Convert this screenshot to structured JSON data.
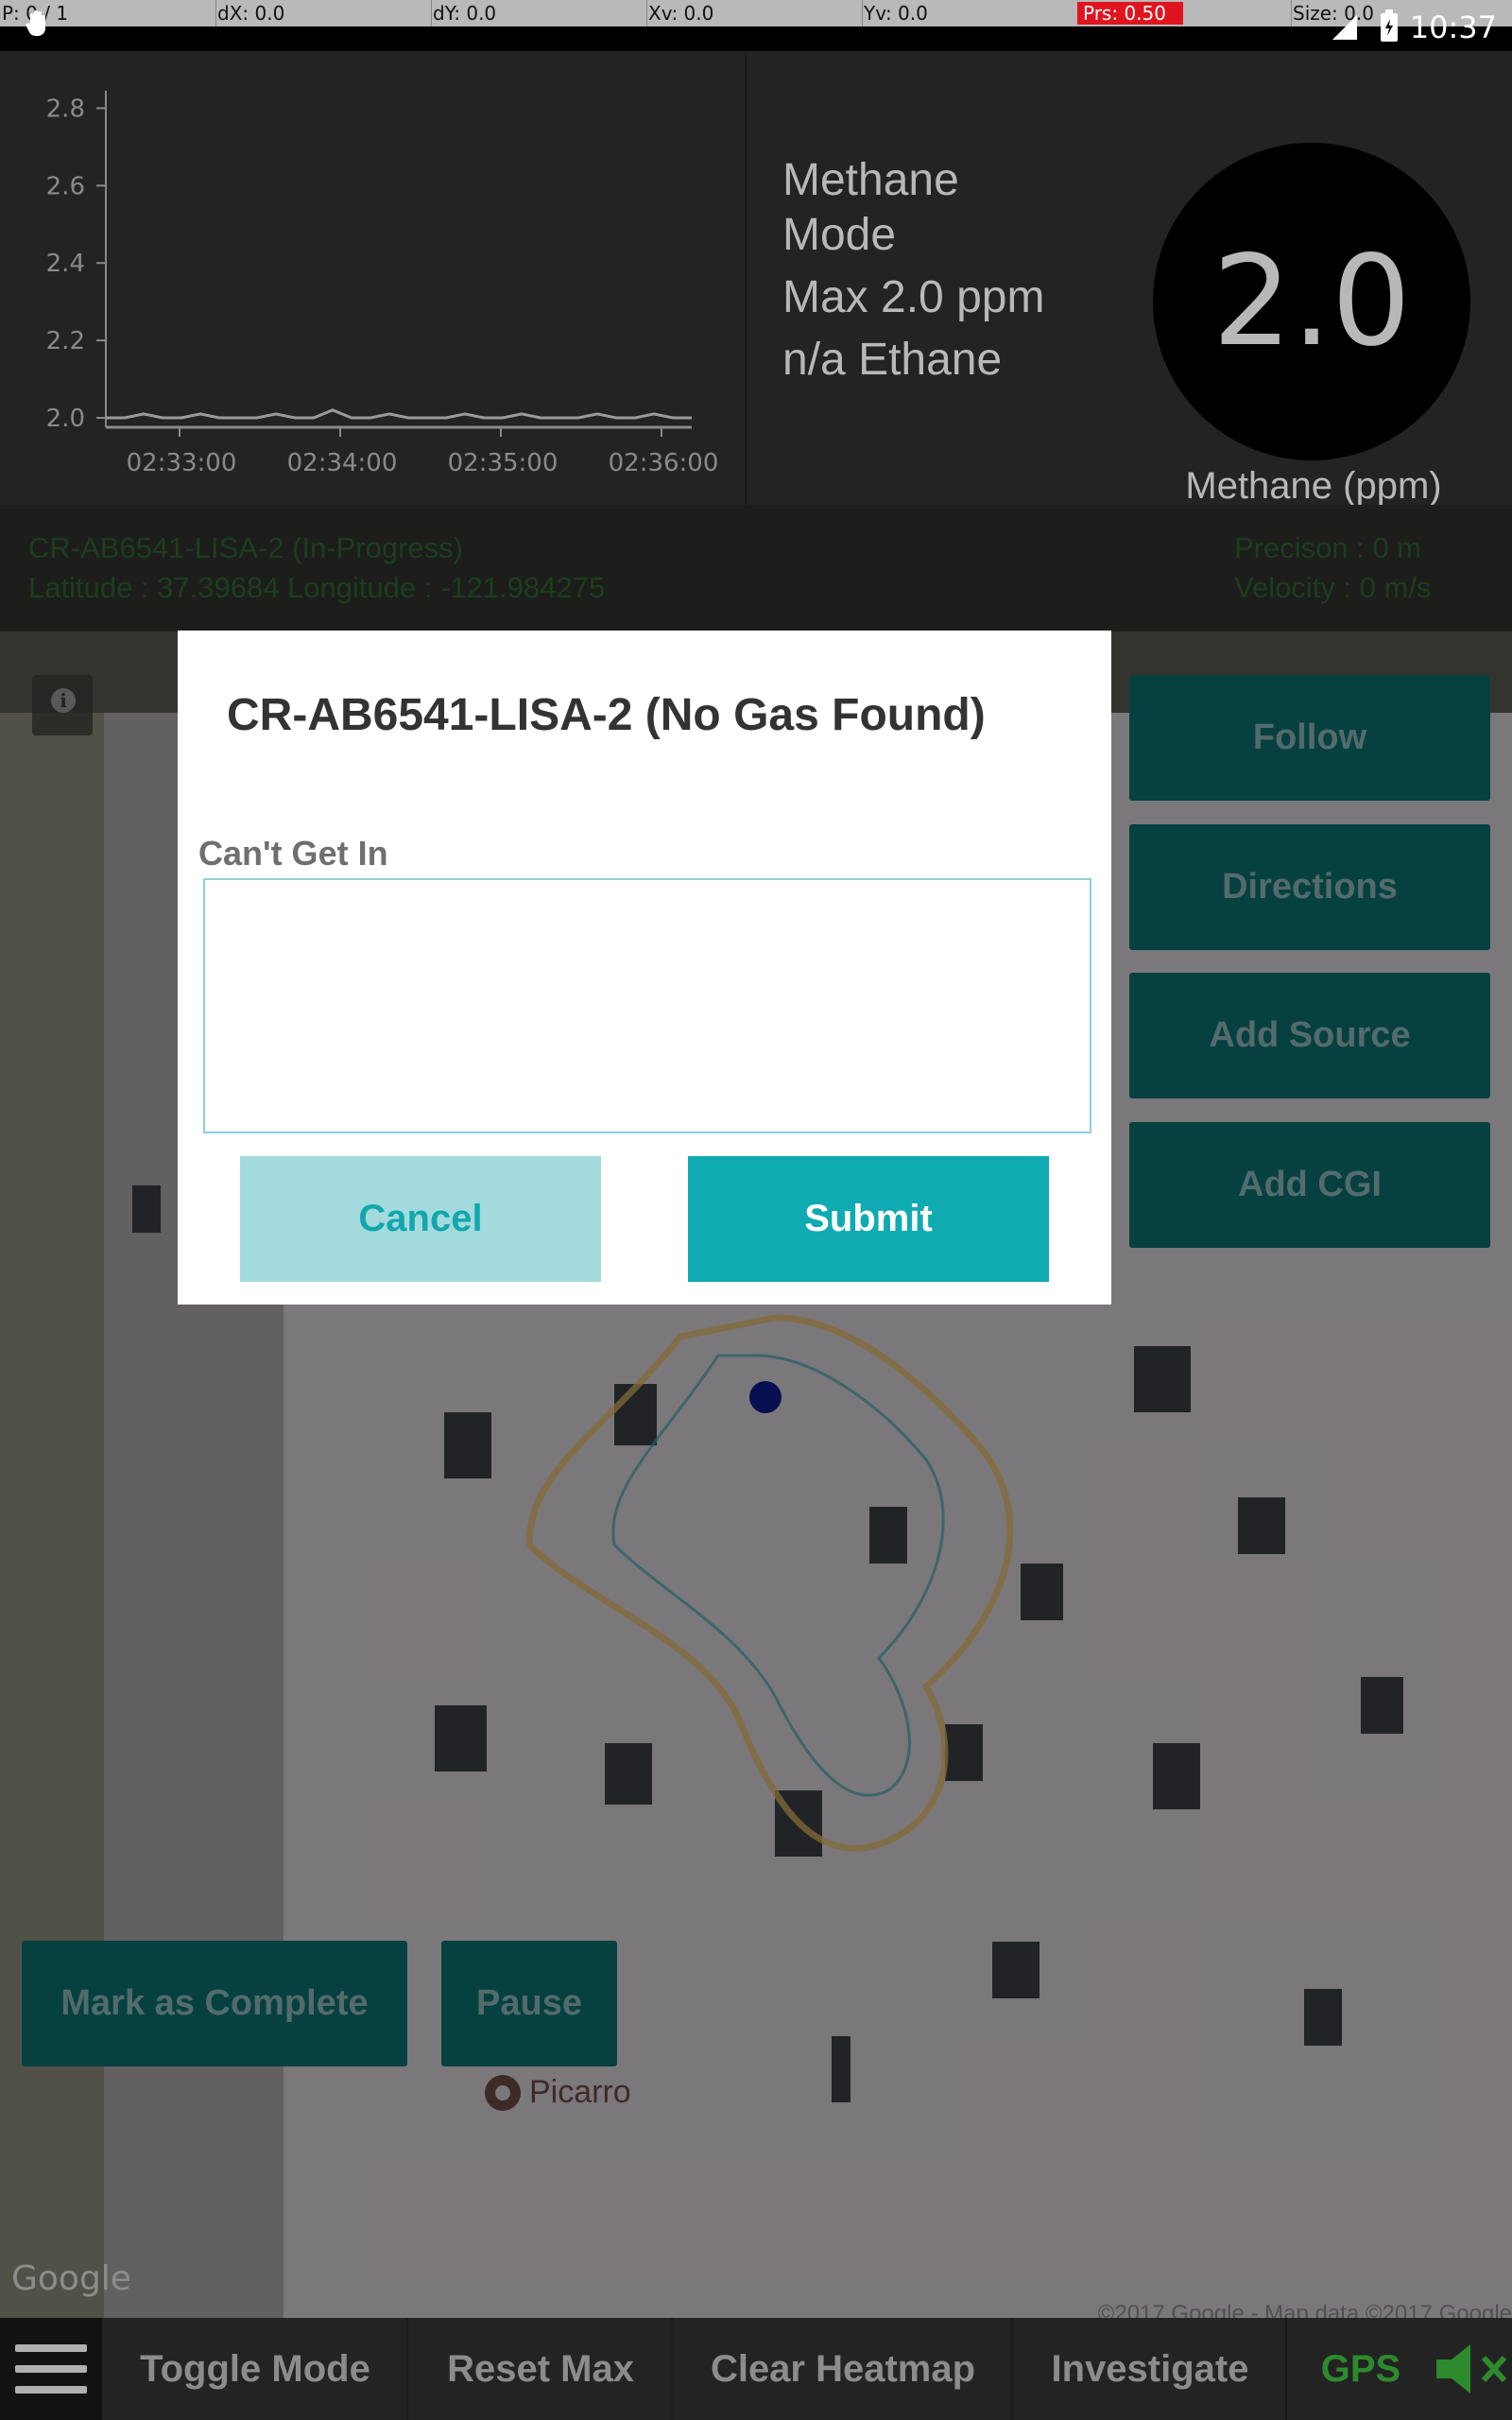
{
  "status_bar": {
    "debug": {
      "p": "P: 0 / 1",
      "dx": "dX: 0.0",
      "dy": "dY: 0.0",
      "xv": "Xv: 0.0",
      "yv": "Yv: 0.0",
      "prs": "Prs: 0.50",
      "size": "Size: 0.0"
    },
    "time": "10:37",
    "icons": [
      "hand-icon",
      "signal-icon",
      "battery-icon"
    ]
  },
  "chart_data": {
    "type": "line",
    "title": "",
    "xlabel": "",
    "ylabel": "",
    "y_ticks": [
      "2.0",
      "2.2",
      "2.4",
      "2.6",
      "2.8"
    ],
    "x_ticks": [
      "02:33:00",
      "02:34:00",
      "02:35:00",
      "02:36:00"
    ],
    "ylim": [
      2.0,
      2.85
    ],
    "series": [
      {
        "values": [
          2.0,
          2.0,
          2.01,
          2.0,
          2.0,
          2.01,
          2.0,
          2.0,
          2.0,
          2.01,
          2.0,
          2.0,
          2.02,
          2.0,
          2.0,
          2.01,
          2.0,
          2.0,
          2.0,
          2.01,
          2.0,
          2.0,
          2.01,
          2.0,
          2.0,
          2.0,
          2.01,
          2.0,
          2.0,
          2.01,
          2.0,
          2.0
        ]
      }
    ],
    "color": "#9a9a9a"
  },
  "readout": {
    "mode_line1": "Methane",
    "mode_line2": "Mode",
    "max": "Max 2.0 ppm",
    "ethane": "n/a Ethane",
    "gauge_value": "2.0",
    "gauge_label": "Methane (ppm)"
  },
  "map_info": {
    "lisa": "CR-AB6541-LISA-2  (In-Progress)",
    "lat_lon": "Latitude : 37.39684  Longitude  :  -121.984275",
    "precision": "Precison : 0  m",
    "velocity": "Velocity : 0  m/s"
  },
  "side_buttons": {
    "follow": "Follow",
    "directions": "Directions",
    "add_source": "Add Source",
    "add_cgi": "Add CGI"
  },
  "map_buttons": {
    "mark_complete": "Mark as Complete",
    "pause": "Pause"
  },
  "map_labels": {
    "place": "Picarro",
    "google": "Google",
    "attribution": "©2017 Google - Map data ©2017 Google"
  },
  "dialog": {
    "title": "CR-AB6541-LISA-2  (No Gas Found)",
    "field_label": "Can't Get In",
    "field_value": "",
    "cancel": "Cancel",
    "submit": "Submit"
  },
  "bottom_bar": {
    "toggle_mode": "Toggle Mode",
    "reset_max": "Reset Max",
    "clear_heatmap": "Clear Heatmap",
    "investigate": "Investigate",
    "gps": "GPS"
  },
  "colors": {
    "accent": "#10aab2",
    "map_button": "#0d6e6e",
    "gps_active": "#2d8a2d"
  }
}
